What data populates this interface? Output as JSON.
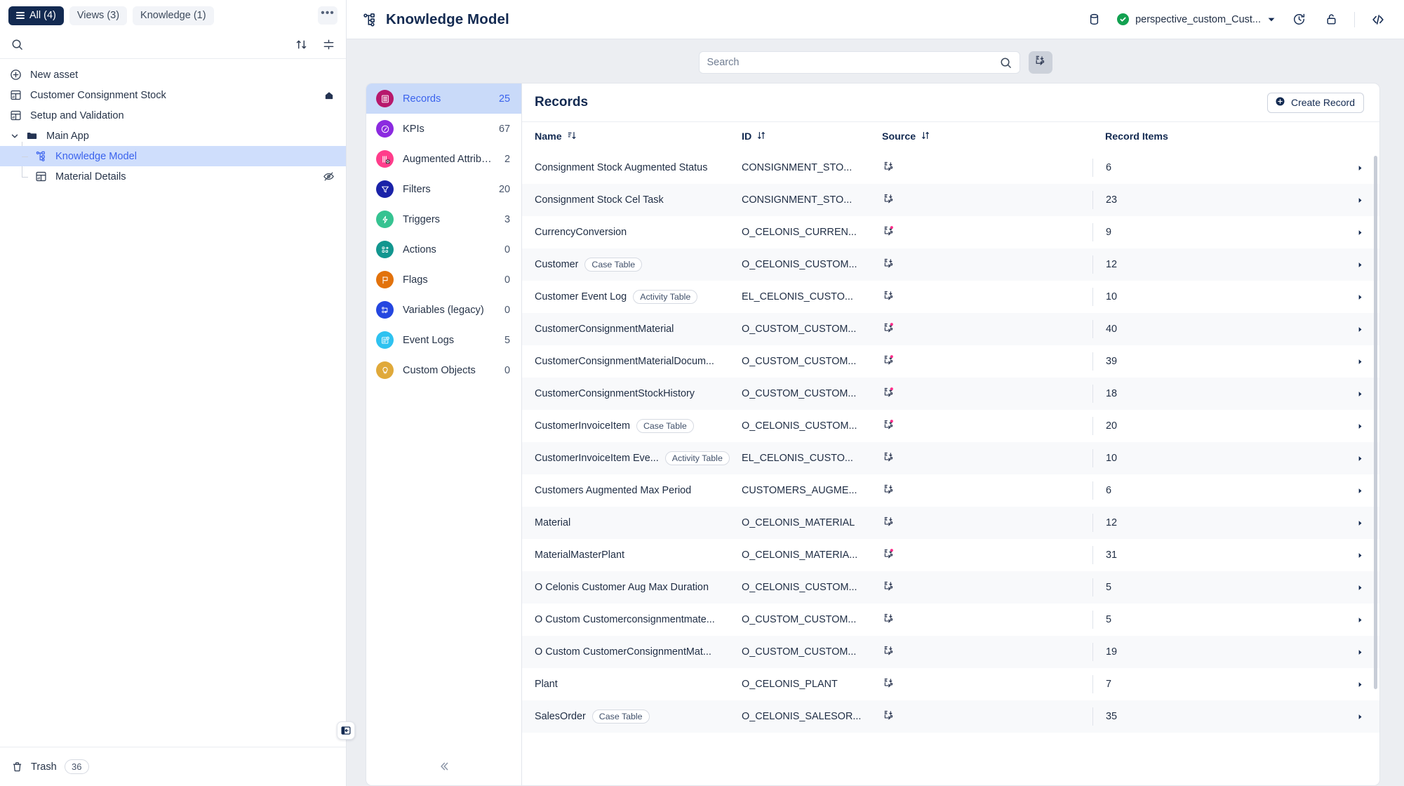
{
  "sidebar": {
    "tabs": [
      {
        "label": "All (4)",
        "active": true,
        "icon": "list-icon"
      },
      {
        "label": "Views (3)",
        "active": false
      },
      {
        "label": "Knowledge (1)",
        "active": false
      }
    ],
    "more_label": "•••",
    "search_placeholder": "",
    "sort_icon": "sort-arrows-icon",
    "filter_icon": "filter-lines-icon",
    "items": [
      {
        "label": "New asset",
        "icon": "plus-circle-icon",
        "depth": 0,
        "selected": false,
        "trailing": ""
      },
      {
        "label": "Customer Consignment Stock",
        "icon": "view-grid-icon",
        "depth": 0,
        "selected": false,
        "trailing": "home-icon"
      },
      {
        "label": "Setup and Validation",
        "icon": "view-grid-icon",
        "depth": 0,
        "selected": false,
        "trailing": ""
      },
      {
        "label": "Main App",
        "icon": "folder-icon",
        "depth": 0,
        "selected": false,
        "trailing": "",
        "expanded": true
      },
      {
        "label": "Knowledge Model",
        "icon": "knowledge-model-icon",
        "depth": 1,
        "selected": true,
        "trailing": ""
      },
      {
        "label": "Material Details",
        "icon": "view-grid-icon",
        "depth": 1,
        "selected": false,
        "trailing": "hidden-eye-icon"
      }
    ],
    "collapse_icon": "panel-collapse-icon",
    "trash": {
      "label": "Trash",
      "count": "36",
      "icon": "trash-icon"
    }
  },
  "topbar": {
    "title": "Knowledge Model",
    "title_icon": "knowledge-model-icon",
    "database_icon": "database-icon",
    "perspective": "perspective_custom_Cust...",
    "perspective_status": "valid",
    "chevron_icon": "chevron-down-icon",
    "history_icon": "history-clock-icon",
    "lock_icon": "unlock-icon",
    "code_icon": "code-brackets-icon"
  },
  "search": {
    "placeholder": "Search",
    "value": "",
    "icon": "search-icon",
    "source_button_icon": "data-source-icon"
  },
  "categories": [
    {
      "label": "Records",
      "count": "25",
      "color": "#b7186c",
      "icon": "records-icon",
      "active": true
    },
    {
      "label": "KPIs",
      "count": "67",
      "color": "#8b2ae0",
      "icon": "kpi-compass-icon",
      "active": false
    },
    {
      "label": "Augmented Attributes",
      "count": "2",
      "color": "#ff3d8b",
      "icon": "augmented-attributes-icon",
      "active": false
    },
    {
      "label": "Filters",
      "count": "20",
      "color": "#1a22a8",
      "icon": "funnel-icon",
      "active": false
    },
    {
      "label": "Triggers",
      "count": "3",
      "color": "#36c391",
      "icon": "trigger-bolt-icon",
      "active": false
    },
    {
      "label": "Actions",
      "count": "0",
      "color": "#12968f",
      "icon": "actions-icon",
      "active": false
    },
    {
      "label": "Flags",
      "count": "0",
      "color": "#e2720c",
      "icon": "flag-icon",
      "active": false
    },
    {
      "label": "Variables (legacy)",
      "count": "0",
      "color": "#2446e0",
      "icon": "variables-icon",
      "active": false
    },
    {
      "label": "Event Logs",
      "count": "5",
      "color": "#2ec2f0",
      "icon": "event-log-icon",
      "active": false
    },
    {
      "label": "Custom Objects",
      "count": "0",
      "color": "#e0a93a",
      "icon": "lightbulb-icon",
      "active": false
    }
  ],
  "category_collapse_icon": "chevrons-left-icon",
  "table": {
    "title": "Records",
    "create_button": "Create Record",
    "create_icon": "plus-circle-icon",
    "columns": [
      {
        "label": "Name",
        "sort": "sort-desc-icon"
      },
      {
        "label": "ID",
        "sort": "sort-both-icon"
      },
      {
        "label": "Source",
        "sort": "sort-both-icon"
      },
      {
        "label": "Record Items",
        "sort": ""
      }
    ],
    "rows": [
      {
        "name": "Consignment Stock Augmented Status",
        "badge": "",
        "id": "CONSIGNMENT_STO...",
        "source": "table-link-icon",
        "custom": false,
        "items": "6"
      },
      {
        "name": "Consignment Stock Cel Task",
        "badge": "",
        "id": "CONSIGNMENT_STO...",
        "source": "table-link-icon",
        "custom": false,
        "items": "23"
      },
      {
        "name": "CurrencyConversion",
        "badge": "",
        "id": "O_CELONIS_CURREN...",
        "source": "table-link-icon",
        "custom": true,
        "items": "9"
      },
      {
        "name": "Customer",
        "badge": "Case Table",
        "id": "O_CELONIS_CUSTOM...",
        "source": "table-link-icon",
        "custom": false,
        "items": "12"
      },
      {
        "name": "Customer Event Log",
        "badge": "Activity Table",
        "id": "EL_CELONIS_CUSTO...",
        "source": "table-link-icon",
        "custom": false,
        "items": "10"
      },
      {
        "name": "CustomerConsignmentMaterial",
        "badge": "",
        "id": "O_CUSTOM_CUSTOM...",
        "source": "table-link-icon",
        "custom": true,
        "items": "40"
      },
      {
        "name": "CustomerConsignmentMaterialDocum...",
        "badge": "",
        "id": "O_CUSTOM_CUSTOM...",
        "source": "table-link-icon",
        "custom": true,
        "items": "39"
      },
      {
        "name": "CustomerConsignmentStockHistory",
        "badge": "",
        "id": "O_CUSTOM_CUSTOM...",
        "source": "table-link-icon",
        "custom": true,
        "items": "18"
      },
      {
        "name": "CustomerInvoiceItem",
        "badge": "Case Table",
        "id": "O_CELONIS_CUSTOM...",
        "source": "table-link-icon",
        "custom": true,
        "items": "20"
      },
      {
        "name": "CustomerInvoiceItem Eve...",
        "badge": "Activity Table",
        "id": "EL_CELONIS_CUSTO...",
        "source": "table-link-icon",
        "custom": false,
        "items": "10"
      },
      {
        "name": "Customers Augmented Max Period",
        "badge": "",
        "id": "CUSTOMERS_AUGME...",
        "source": "table-link-icon",
        "custom": false,
        "items": "6"
      },
      {
        "name": "Material",
        "badge": "",
        "id": "O_CELONIS_MATERIAL",
        "source": "table-link-icon",
        "custom": false,
        "items": "12"
      },
      {
        "name": "MaterialMasterPlant",
        "badge": "",
        "id": "O_CELONIS_MATERIA...",
        "source": "table-link-icon",
        "custom": true,
        "items": "31"
      },
      {
        "name": "O Celonis Customer Aug Max Duration",
        "badge": "",
        "id": "O_CELONIS_CUSTOM...",
        "source": "table-link-icon",
        "custom": false,
        "items": "5"
      },
      {
        "name": "O Custom Customerconsignmentmate...",
        "badge": "",
        "id": "O_CUSTOM_CUSTOM...",
        "source": "table-link-icon",
        "custom": false,
        "items": "5"
      },
      {
        "name": "O Custom CustomerConsignmentMat...",
        "badge": "",
        "id": "O_CUSTOM_CUSTOM...",
        "source": "table-link-icon",
        "custom": false,
        "items": "19"
      },
      {
        "name": "Plant",
        "badge": "",
        "id": "O_CELONIS_PLANT",
        "source": "table-link-icon",
        "custom": false,
        "items": "7"
      },
      {
        "name": "SalesOrder",
        "badge": "Case Table",
        "id": "O_CELONIS_SALESOR...",
        "source": "table-link-icon",
        "custom": false,
        "items": "35"
      }
    ]
  },
  "colors": {
    "accent": "#3b63ed",
    "dark": "#132a51",
    "selection": "#c9daf9",
    "custom_dot": "#ff2d8a"
  }
}
